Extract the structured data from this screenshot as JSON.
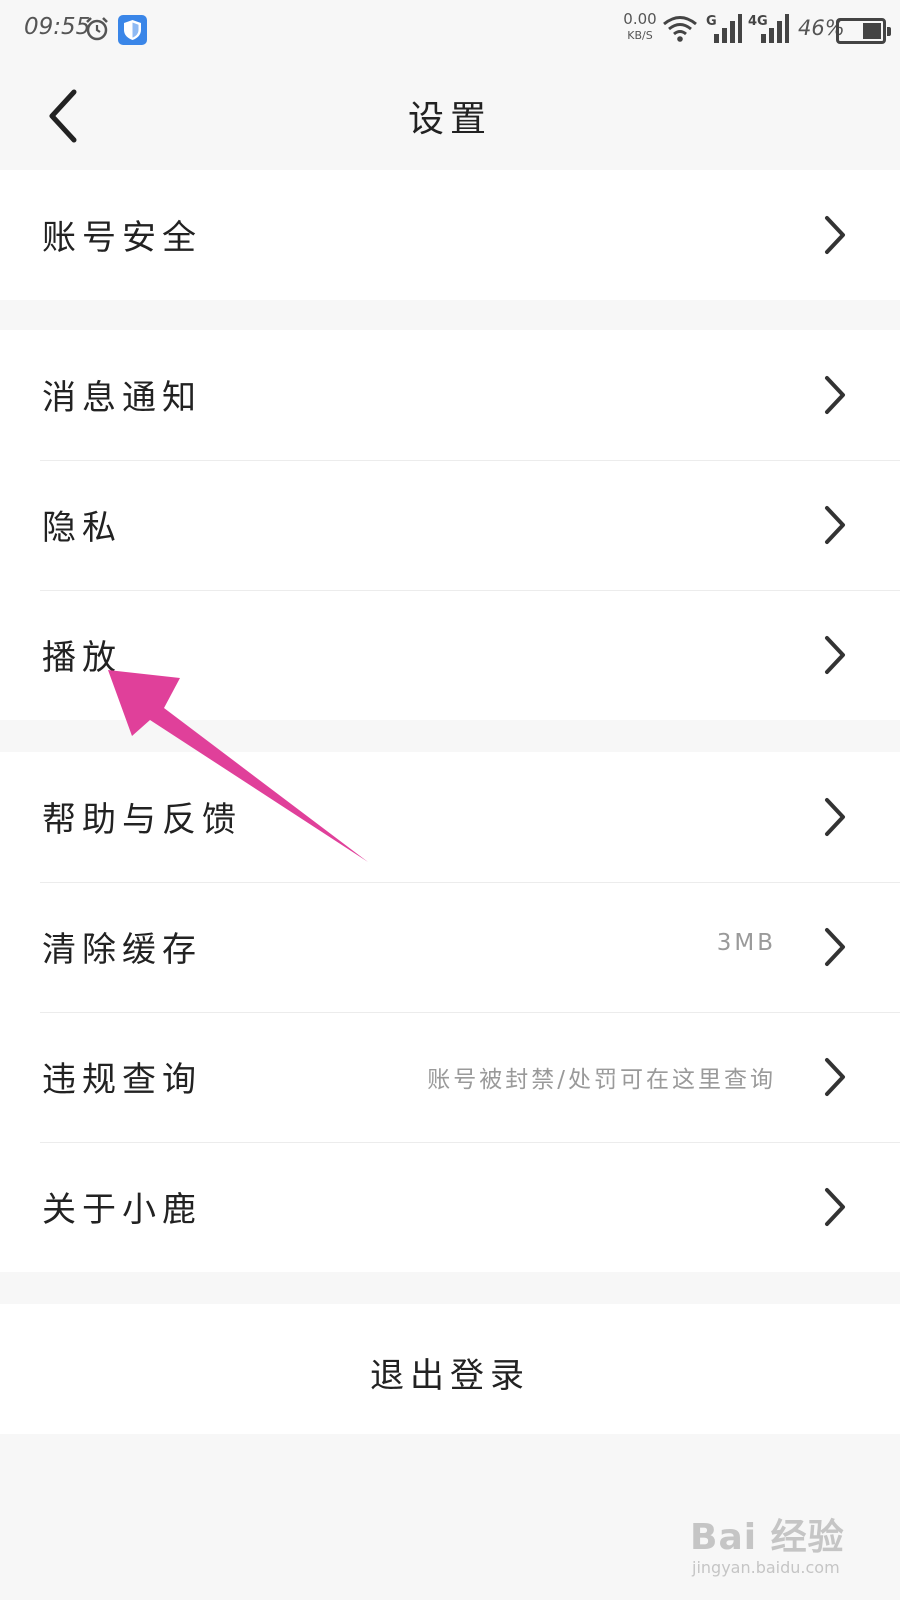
{
  "status_bar": {
    "time": "09:55",
    "net_speed_value": "0.00",
    "net_speed_unit": "KB/S",
    "signal_1_label": "G",
    "signal_2_label": "4G",
    "battery_percent": "46%",
    "battery_level": 0.46
  },
  "header": {
    "title": "设置"
  },
  "groups": [
    {
      "items": [
        {
          "label": "账号安全",
          "value": ""
        }
      ]
    },
    {
      "items": [
        {
          "label": "消息通知",
          "value": ""
        },
        {
          "label": "隐私",
          "value": ""
        },
        {
          "label": "播放",
          "value": ""
        }
      ]
    },
    {
      "items": [
        {
          "label": "帮助与反馈",
          "value": ""
        },
        {
          "label": "清除缓存",
          "value": "3MB"
        },
        {
          "label": "违规查询",
          "value": "账号被封禁/处罚可在这里查询"
        },
        {
          "label": "关于小鹿",
          "value": ""
        }
      ]
    }
  ],
  "logout_label": "退出登录",
  "annotation": {
    "color": "#e0409a"
  },
  "watermark": {
    "logo_text": "Bai 经验",
    "url": "jingyan.baidu.com"
  }
}
